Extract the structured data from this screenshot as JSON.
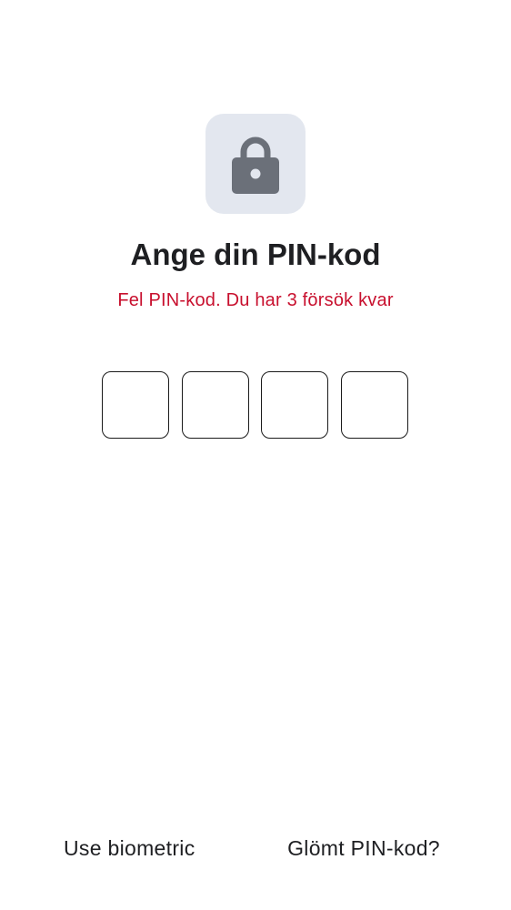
{
  "screen": {
    "icon": "lock-icon",
    "title": "Ange din PIN-kod",
    "error_message": "Fel PIN-kod. Du har 3 försök kvar",
    "pin": {
      "length": 4,
      "digits": [
        "",
        "",
        "",
        ""
      ]
    }
  },
  "footer": {
    "biometric_label": "Use biometric",
    "forgot_label": "Glömt PIN-kod?"
  },
  "colors": {
    "error": "#c8102e",
    "icon_tile": "#e3e7ef",
    "icon": "#6b7079",
    "text": "#1e1f22"
  }
}
